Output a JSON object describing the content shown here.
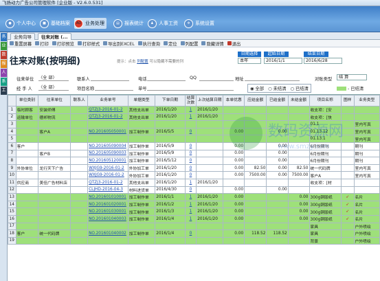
{
  "window_title": "飞扬动力广告公司管理软件 [企业版 - V2.6.0.531]",
  "modules": [
    "个人中心",
    "基础档案",
    "业务处理",
    "报表统计",
    "人事工资",
    "系统设置"
  ],
  "sidebar": [
    "务",
    "业",
    "数",
    "报",
    "人",
    "系",
    "工"
  ],
  "tabs": [
    "业务向导",
    "往来对账 (..."
  ],
  "toolbar": [
    "重置屏幕",
    "打印",
    "打印预览",
    "打印样式",
    "导出到EXCEL",
    "执行查询",
    "定位",
    "列配置",
    "隐藏详情",
    "退出"
  ],
  "page_title": "往来对账(按明细)",
  "hint": {
    "prefix": "提示：点击",
    "link": "列配置",
    "suffix": "可以隐藏不需要的列"
  },
  "date_filter": {
    "labels": [
      "日期选择",
      "起始日期",
      "结束日期"
    ],
    "values": [
      "本年",
      "2016/1/1",
      "2016/6/28"
    ]
  },
  "filters": {
    "row1": [
      "往来单位",
      "〈全 部〉",
      "联系人",
      "电话",
      "QQ",
      "地址",
      "对账类型",
      "结 算"
    ],
    "row2": [
      "经 手 人",
      "〈全 部〉",
      "项目名称",
      "单号"
    ],
    "radios": [
      "全部",
      "未结清",
      "已结清"
    ],
    "done_label": "已结清"
  },
  "columns": [
    "",
    "单位类别",
    "往来单位",
    "联系人",
    "业务单号",
    "单据类型",
    "下单日期",
    "结算次数",
    "上次结算日期",
    "本单优惠",
    "应结金额",
    "已结金额",
    "未结金额",
    "项目名称",
    "图样",
    "业务类型"
  ],
  "rows": [
    {
      "n": "1",
      "cat": "临时顾客",
      "unit": "安装师傅",
      "contact": "",
      "no": "QTZJ3-2016-01-2",
      "type": "其他支出单",
      "date": "2016/1/20",
      "cnt": "1",
      "last": "2016/1/20",
      "disc": "",
      "due": "",
      "paid": "",
      "unpaid": "",
      "item": "收支项：[安",
      "pic": "",
      "biz": "",
      "g": 1
    },
    {
      "n": "2",
      "cat": "运输单位",
      "unit": "德邦物流",
      "contact": "",
      "no": "QTZJ3-2016-01-2",
      "type": "其他支出单",
      "date": "2016/1/20",
      "cnt": "1",
      "last": "2016/1/20",
      "disc": "",
      "due": "",
      "paid": "",
      "unpaid": "",
      "item": "收支项：[快",
      "pic": "",
      "biz": "",
      "g": 1
    },
    {
      "n": "3",
      "cat": "",
      "unit": "",
      "contact": "",
      "no": "",
      "type": "",
      "date": "",
      "cnt": "",
      "last": "",
      "disc": "",
      "due": "",
      "paid": "",
      "unpaid": "",
      "item": "01.1",
      "pic": "",
      "biz": "室内写真",
      "g": 1
    },
    {
      "n": "4",
      "cat": "",
      "unit": "客户A",
      "contact": "",
      "no": "NO.201605050001",
      "type": "加工制作单",
      "date": "2016/5/5",
      "cnt": "0",
      "last": "",
      "disc": "0.00",
      "due": "",
      "paid": "0.00",
      "unpaid": "",
      "item": "01.13.12",
      "pic": "",
      "biz": "室内写真",
      "g": 1
    },
    {
      "n": "5",
      "cat": "",
      "unit": "",
      "contact": "",
      "no": "",
      "type": "",
      "date": "",
      "cnt": "",
      "last": "",
      "disc": "",
      "due": "",
      "paid": "",
      "unpaid": "",
      "item": "01.13.1",
      "pic": "",
      "biz": "室内写真",
      "g": 1
    },
    {
      "n": "6",
      "cat": "客户",
      "unit": "",
      "contact": "",
      "no": "NO.201605090004",
      "type": "加工制作单",
      "date": "2016/5/9",
      "cnt": "0",
      "last": "",
      "disc": "0.00",
      "due": "",
      "paid": "0.00",
      "unpaid": "",
      "item": "6月份期刊",
      "pic": "",
      "biz": "期刊",
      "g": 0
    },
    {
      "n": "7",
      "cat": "",
      "unit": "客户B",
      "contact": "",
      "no": "NO.201605090003",
      "type": "加工制作单",
      "date": "2016/5/9",
      "cnt": "0",
      "last": "",
      "disc": "0.00",
      "due": "",
      "paid": "0.00",
      "unpaid": "",
      "item": "6月份期刊",
      "pic": "",
      "biz": "期刊",
      "g": 0
    },
    {
      "n": "8",
      "cat": "",
      "unit": "",
      "contact": "",
      "no": "NO.201605120001",
      "type": "加工制作单",
      "date": "2016/5/12",
      "cnt": "0",
      "last": "",
      "disc": "0.00",
      "due": "",
      "paid": "0.00",
      "unpaid": "",
      "item": "6月份期刊",
      "pic": "",
      "biz": "期刊",
      "g": 0
    },
    {
      "n": "9",
      "cat": "外协单位",
      "unit": "龙行天下广告",
      "contact": "",
      "no": "WXJG9-2016-01-2",
      "type": "外协加工单",
      "date": "2016/1/20",
      "cnt": "0",
      "last": "",
      "disc": "0.00",
      "due": "82.50",
      "paid": "0.00",
      "unpaid": "82.50",
      "item": "统一代码牌",
      "pic": "",
      "biz": "室内写真",
      "g": 0
    },
    {
      "n": "10",
      "cat": "",
      "unit": "",
      "contact": "",
      "no": "WXJG9-2016-01-2",
      "type": "外协加工单",
      "date": "2016/1/20",
      "cnt": "0",
      "last": "",
      "disc": "0.00",
      "due": "7500.00",
      "paid": "0.00",
      "unpaid": "7500.00",
      "item": "客户A",
      "pic": "",
      "biz": "室内写真",
      "g": 0
    },
    {
      "n": "11",
      "cat": "供应商",
      "unit": "美佳广告材料店",
      "contact": "",
      "no": "QTZJ3-2016-01-2",
      "type": "其他支出单",
      "date": "2016/1/20",
      "cnt": "1",
      "last": "2016/1/20",
      "disc": "",
      "due": "",
      "paid": "",
      "unpaid": "",
      "item": "收支项：[材",
      "pic": "",
      "biz": "",
      "g": 0
    },
    {
      "n": "12",
      "cat": "",
      "unit": "",
      "contact": "",
      "no": "CLJHD-2016-04-3",
      "type": "材料进货单",
      "date": "2016/4/30",
      "cnt": "0",
      "last": "",
      "disc": "0.00",
      "due": "",
      "paid": "0.00",
      "unpaid": "",
      "item": "",
      "pic": "",
      "biz": "",
      "g": 0
    },
    {
      "n": "13",
      "cat": "",
      "unit": "",
      "contact": "",
      "no": "NO.201601010001",
      "type": "加工制作单",
      "date": "2016/1/1",
      "cnt": "1",
      "last": "2016/1/20",
      "disc": "0.00",
      "due": "",
      "paid": "",
      "unpaid": "0.00",
      "item": "300g铜版纸",
      "pic": "➶",
      "biz": "名片",
      "g": 1
    },
    {
      "n": "14",
      "cat": "",
      "unit": "",
      "contact": "",
      "no": "NO.201601020001",
      "type": "加工制作单",
      "date": "2016/1/2",
      "cnt": "1",
      "last": "2016/1/20",
      "disc": "0.00",
      "due": "",
      "paid": "",
      "unpaid": "0.00",
      "item": "300g铜版纸",
      "pic": "➶",
      "biz": "名片",
      "g": 1
    },
    {
      "n": "15",
      "cat": "",
      "unit": "",
      "contact": "",
      "no": "NO.201601030001",
      "type": "加工制作单",
      "date": "2016/1/3",
      "cnt": "1",
      "last": "2016/1/20",
      "disc": "0.00",
      "due": "",
      "paid": "",
      "unpaid": "0.00",
      "item": "300g铜版纸",
      "pic": "➶",
      "biz": "名片",
      "g": 1
    },
    {
      "n": "16",
      "cat": "",
      "unit": "",
      "contact": "",
      "no": "NO.201601040003",
      "type": "加工制作单",
      "date": "2016/1/4",
      "cnt": "1",
      "last": "2016/1/20",
      "disc": "0.00",
      "due": "",
      "paid": "",
      "unpaid": "0.00",
      "item": "300g铜版纸",
      "pic": "➶",
      "biz": "名片",
      "g": 1
    },
    {
      "n": "17",
      "cat": "",
      "unit": "",
      "contact": "",
      "no": "",
      "type": "",
      "date": "",
      "cnt": "",
      "last": "",
      "disc": "",
      "due": "",
      "paid": "",
      "unpaid": "",
      "item": "家具",
      "pic": "",
      "biz": "户外喷绘",
      "g": 1
    },
    {
      "n": "18",
      "cat": "客户",
      "unit": "统一代码牌",
      "contact": "",
      "no": "NO.201601040002",
      "type": "加工制作单",
      "date": "2016/1/4",
      "cnt": "0",
      "last": "",
      "disc": "0.00",
      "due": "118.52",
      "paid": "118.52",
      "unpaid": "",
      "item": "家具",
      "pic": "",
      "biz": "户外喷绘",
      "g": 1
    },
    {
      "n": "19",
      "cat": "",
      "unit": "",
      "contact": "",
      "no": "",
      "type": "",
      "date": "",
      "cnt": "",
      "last": "",
      "disc": "",
      "due": "",
      "paid": "",
      "unpaid": "",
      "item": "背景",
      "pic": "",
      "biz": "户外喷绘",
      "g": 1
    }
  ],
  "watermark": {
    "name": "数码资源网",
    "url": "www.smzy.com"
  }
}
